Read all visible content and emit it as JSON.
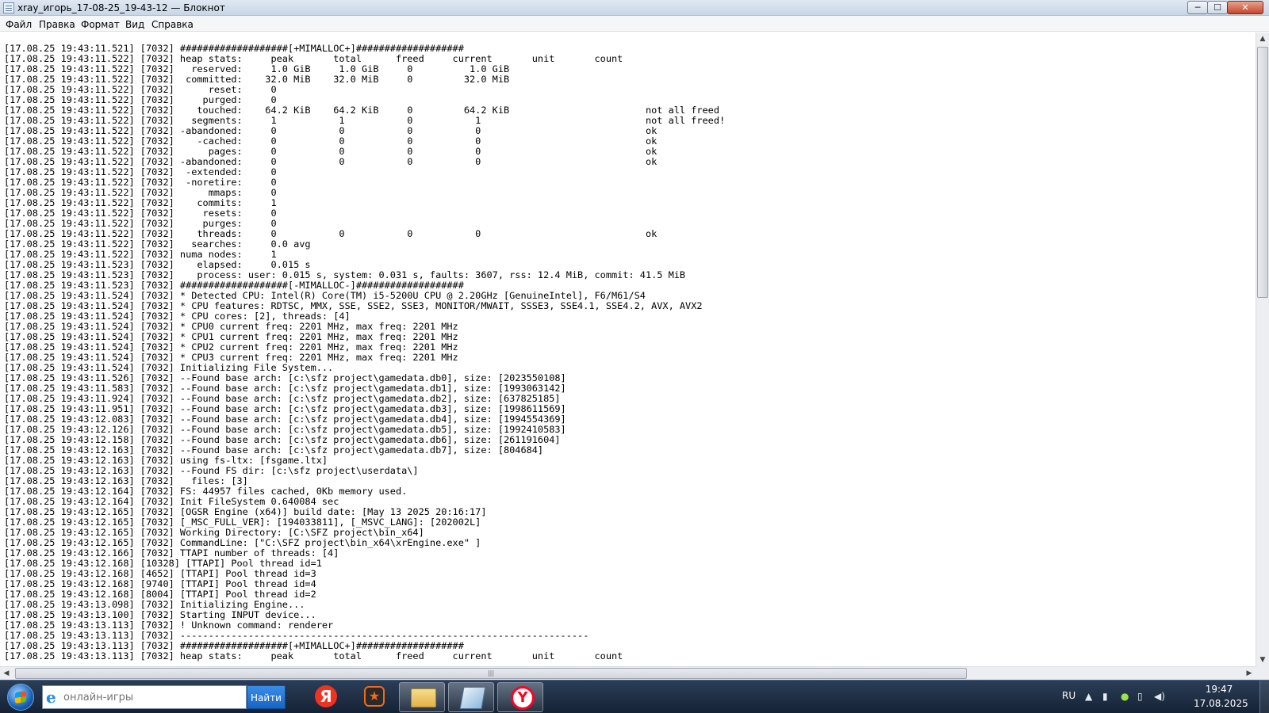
{
  "window": {
    "title": "xray_игорь_17-08-25_19-43-12 — Блокнот",
    "min_label": "─",
    "max_label": "☐",
    "close_label": "✕"
  },
  "menu": [
    "Файл",
    "Правка",
    "Формат",
    "Вид",
    "Справка"
  ],
  "log_lines": [
    "[17.08.25 19:43:11.521] [7032] ###################[+MIMALLOC+]###################",
    "[17.08.25 19:43:11.522] [7032] heap stats:     peak       total      freed     current       unit       count",
    "[17.08.25 19:43:11.522] [7032]   reserved:     1.0 GiB     1.0 GiB     0          1.0 GiB",
    "[17.08.25 19:43:11.522] [7032]  committed:    32.0 MiB    32.0 MiB     0         32.0 MiB",
    "[17.08.25 19:43:11.522] [7032]      reset:     0",
    "[17.08.25 19:43:11.522] [7032]     purged:     0",
    "[17.08.25 19:43:11.522] [7032]    touched:    64.2 KiB    64.2 KiB     0         64.2 KiB                        not all freed",
    "[17.08.25 19:43:11.522] [7032]   segments:     1           1           0           1                             not all freed!",
    "[17.08.25 19:43:11.522] [7032] -abandoned:     0           0           0           0                             ok",
    "[17.08.25 19:43:11.522] [7032]    -cached:     0           0           0           0                             ok",
    "[17.08.25 19:43:11.522] [7032]      pages:     0           0           0           0                             ok",
    "[17.08.25 19:43:11.522] [7032] -abandoned:     0           0           0           0                             ok",
    "[17.08.25 19:43:11.522] [7032]  -extended:     0",
    "[17.08.25 19:43:11.522] [7032]  -noretire:     0",
    "[17.08.25 19:43:11.522] [7032]      mmaps:     0",
    "[17.08.25 19:43:11.522] [7032]    commits:     1",
    "[17.08.25 19:43:11.522] [7032]     resets:     0",
    "[17.08.25 19:43:11.522] [7032]     purges:     0",
    "[17.08.25 19:43:11.522] [7032]    threads:     0           0           0           0                             ok",
    "[17.08.25 19:43:11.522] [7032]   searches:     0.0 avg",
    "[17.08.25 19:43:11.522] [7032] numa nodes:     1",
    "[17.08.25 19:43:11.523] [7032]    elapsed:     0.015 s",
    "[17.08.25 19:43:11.523] [7032]    process: user: 0.015 s, system: 0.031 s, faults: 3607, rss: 12.4 MiB, commit: 41.5 MiB",
    "[17.08.25 19:43:11.523] [7032] ###################[-MIMALLOC-]###################",
    "[17.08.25 19:43:11.524] [7032] * Detected CPU: Intel(R) Core(TM) i5-5200U CPU @ 2.20GHz [GenuineIntel], F6/M61/S4",
    "[17.08.25 19:43:11.524] [7032] * CPU features: RDTSC, MMX, SSE, SSE2, SSE3, MONITOR/MWAIT, SSSE3, SSE4.1, SSE4.2, AVX, AVX2",
    "[17.08.25 19:43:11.524] [7032] * CPU cores: [2], threads: [4]",
    "[17.08.25 19:43:11.524] [7032] * CPU0 current freq: 2201 MHz, max freq: 2201 MHz",
    "[17.08.25 19:43:11.524] [7032] * CPU1 current freq: 2201 MHz, max freq: 2201 MHz",
    "[17.08.25 19:43:11.524] [7032] * CPU2 current freq: 2201 MHz, max freq: 2201 MHz",
    "[17.08.25 19:43:11.524] [7032] * CPU3 current freq: 2201 MHz, max freq: 2201 MHz",
    "[17.08.25 19:43:11.524] [7032] Initializing File System...",
    "[17.08.25 19:43:11.526] [7032] --Found base arch: [c:\\sfz project\\gamedata.db0], size: [2023550108]",
    "[17.08.25 19:43:11.583] [7032] --Found base arch: [c:\\sfz project\\gamedata.db1], size: [1993063142]",
    "[17.08.25 19:43:11.924] [7032] --Found base arch: [c:\\sfz project\\gamedata.db2], size: [637825185]",
    "[17.08.25 19:43:11.951] [7032] --Found base arch: [c:\\sfz project\\gamedata.db3], size: [1998611569]",
    "[17.08.25 19:43:12.083] [7032] --Found base arch: [c:\\sfz project\\gamedata.db4], size: [1994554369]",
    "[17.08.25 19:43:12.126] [7032] --Found base arch: [c:\\sfz project\\gamedata.db5], size: [1992410583]",
    "[17.08.25 19:43:12.158] [7032] --Found base arch: [c:\\sfz project\\gamedata.db6], size: [261191604]",
    "[17.08.25 19:43:12.163] [7032] --Found base arch: [c:\\sfz project\\gamedata.db7], size: [804684]",
    "[17.08.25 19:43:12.163] [7032] using fs-ltx: [fsgame.ltx]",
    "[17.08.25 19:43:12.163] [7032] --Found FS dir: [c:\\sfz project\\userdata\\]",
    "[17.08.25 19:43:12.163] [7032]   files: [3]",
    "[17.08.25 19:43:12.164] [7032] FS: 44957 files cached, 0Kb memory used.",
    "[17.08.25 19:43:12.164] [7032] Init FileSystem 0.640084 sec",
    "[17.08.25 19:43:12.165] [7032] [OGSR Engine (x64)] build date: [May 13 2025 20:16:17]",
    "[17.08.25 19:43:12.165] [7032] [_MSC_FULL_VER]: [194033811], [_MSVC_LANG]: [202002L]",
    "[17.08.25 19:43:12.165] [7032] Working Directory: [C:\\SFZ project\\bin_x64]",
    "[17.08.25 19:43:12.165] [7032] CommandLine: [\"C:\\SFZ project\\bin_x64\\xrEngine.exe\" ]",
    "[17.08.25 19:43:12.166] [7032] TTAPI number of threads: [4]",
    "[17.08.25 19:43:12.168] [10328] [TTAPI] Pool thread id=1",
    "[17.08.25 19:43:12.168] [4652] [TTAPI] Pool thread id=3",
    "[17.08.25 19:43:12.168] [9740] [TTAPI] Pool thread id=4",
    "[17.08.25 19:43:12.168] [8004] [TTAPI] Pool thread id=2",
    "[17.08.25 19:43:13.098] [7032] Initializing Engine...",
    "[17.08.25 19:43:13.100] [7032] Starting INPUT device...",
    "[17.08.25 19:43:13.113] [7032] ! Unknown command: renderer",
    "[17.08.25 19:43:13.113] [7032] ------------------------------------------------------------------------",
    "[17.08.25 19:43:13.113] [7032] ###################[+MIMALLOC+]###################",
    "[17.08.25 19:43:13.113] [7032] heap stats:     peak       total      freed     current       unit       count"
  ],
  "taskbar": {
    "search_placeholder": "онлайн-игры",
    "search_button": "Найти",
    "ie_glyph": "e",
    "yandex_glyph": "Я",
    "app2_glyph": "★",
    "browser_glyph": "Y",
    "lang": "RU",
    "time": "19:47",
    "date": "17.08.2025",
    "icons": [
      "arrow-up-icon",
      "network-icon",
      "shield-icon",
      "battery-icon",
      "speaker-icon"
    ]
  },
  "scrollbar_glyphs": {
    "up": "▲",
    "down": "▼",
    "left": "◀",
    "right": "▶",
    "grip": "|||"
  }
}
